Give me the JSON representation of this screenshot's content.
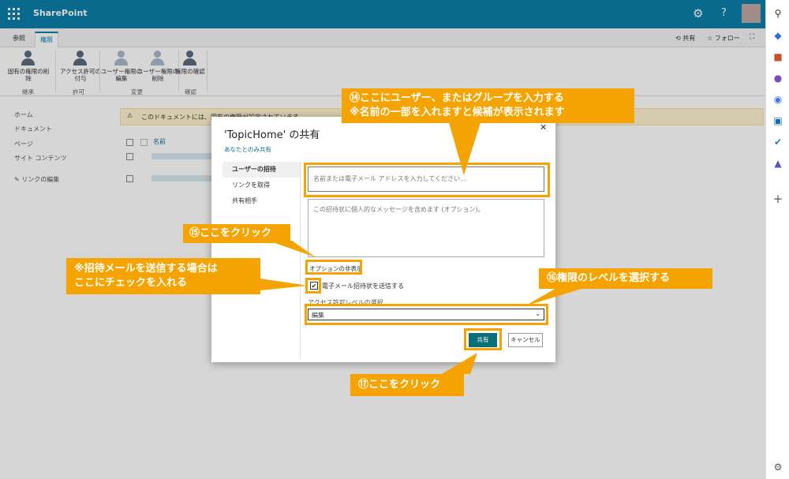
{
  "header": {
    "brand": "SharePoint",
    "icons": [
      "waffle-icon",
      "gear-icon",
      "help-icon"
    ]
  },
  "rail_icons": [
    "search-icon",
    "tag-icon",
    "briefcase-icon",
    "person-icon",
    "copilot-icon",
    "outlook-icon",
    "forms-icon",
    "teams-icon",
    "plus-icon",
    "settings-icon"
  ],
  "ribbon": {
    "tabs": [
      "参照",
      "権限"
    ],
    "right": {
      "share": "共有",
      "follow": "フォロー"
    },
    "buttons": [
      {
        "label": "固有の権限の削除"
      },
      {
        "label": "アクセス許可の付与"
      },
      {
        "label": "ユーザー権限の編集"
      },
      {
        "label": "ユーザー権限の削除"
      },
      {
        "label": "権限の確認"
      }
    ],
    "groups": [
      "継承",
      "許可",
      "変更",
      "確認"
    ]
  },
  "nav": {
    "items": [
      "ホーム",
      "ドキュメント",
      "ページ",
      "サイト コンテンツ"
    ],
    "edit_links": "リンクの編集"
  },
  "content": {
    "warning": "このドキュメントには、固有の権限が設定されています。",
    "column_name": "名前"
  },
  "dialog": {
    "title": "'TopicHome' の共有",
    "subtitle": "あなたとのみ共有",
    "tabs": [
      "ユーザーの招待",
      "リンクを取得",
      "共有相手"
    ],
    "to_placeholder": "名前または電子メール アドレスを入力してください...",
    "message_placeholder": "この招待状に個人的なメッセージを含めます (オプション)。",
    "options_link": "オプションの非表示",
    "send_email_label": "電子メール招待状を送信する",
    "send_email_checked": true,
    "permission_label": "アクセス許可レベルの選択",
    "permission_value": "編集",
    "share_button": "共有",
    "cancel_button": "キャンセル"
  },
  "annotations": {
    "a14_line1": "⑭ここにユーザー、またはグループを入力する",
    "a14_line2": "※名前の一部を入れますと候補が表示されます",
    "a15": "⑮ここをクリック",
    "check_line1": "※招待メールを送信する場合は",
    "check_line2": "ここにチェックを入れる",
    "a16": "⑯権限のレベルを選択する",
    "a17": "⑰ここをクリック"
  },
  "colors": {
    "topbar": "#0b7fa8",
    "accent": "#f5a300",
    "share_button": "#0a6f77"
  }
}
